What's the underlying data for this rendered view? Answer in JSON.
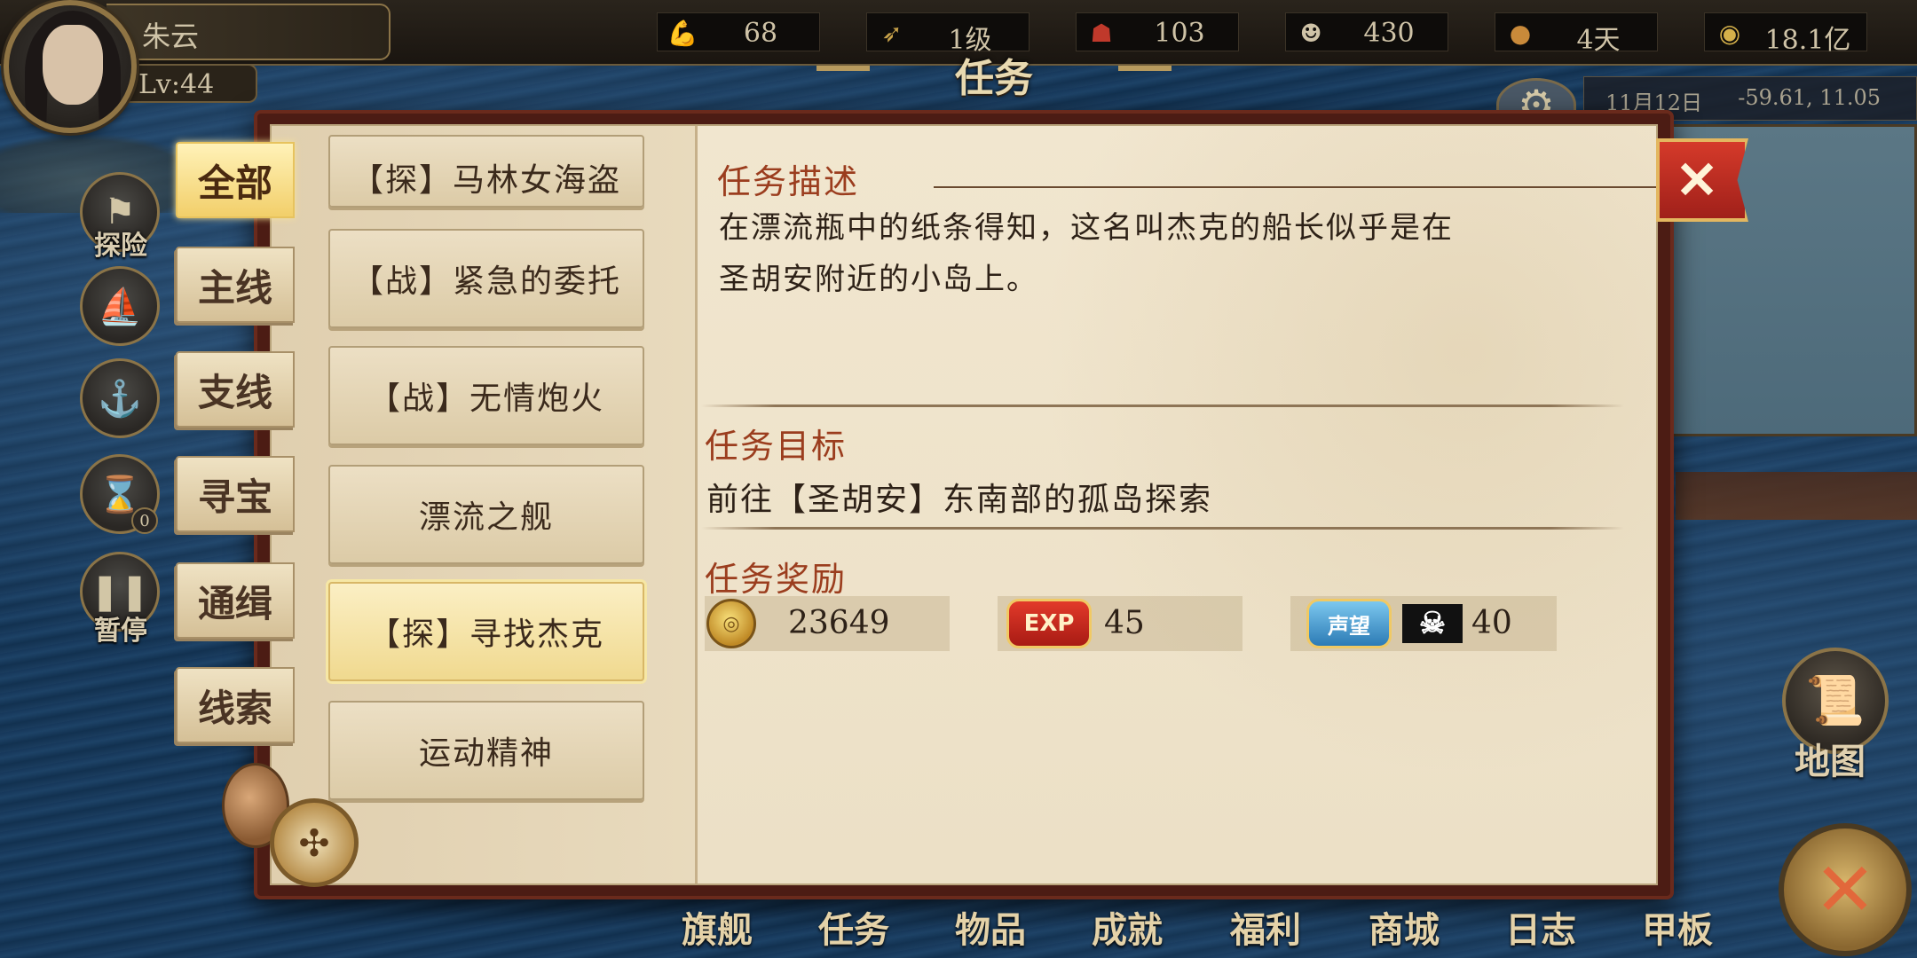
{
  "player": {
    "name": "朱云",
    "level": "Lv:44"
  },
  "stats": [
    {
      "icon": "muscle-icon",
      "value": "68"
    },
    {
      "icon": "arrow-icon",
      "value": "1级"
    },
    {
      "icon": "crew-icon",
      "value": "103"
    },
    {
      "icon": "sailor-icon",
      "value": "430"
    },
    {
      "icon": "bread-icon",
      "value": "4天"
    },
    {
      "icon": "coin-icon",
      "value": "18.1亿"
    }
  ],
  "title": "任务",
  "location": {
    "date": "11月12日",
    "coords": "-59.61, 11.05"
  },
  "side_buttons": [
    {
      "icon": "flag-icon",
      "label": "探险"
    },
    {
      "icon": "ship-icon",
      "label": ""
    },
    {
      "icon": "anchor-icon",
      "label": ""
    },
    {
      "icon": "hourglass-icon",
      "label": "",
      "badge": "0"
    },
    {
      "icon": "pause-icon",
      "label": "暂停"
    }
  ],
  "categories": [
    "全部",
    "主线",
    "支线",
    "寻宝",
    "通缉",
    "线索"
  ],
  "active_category": "全部",
  "tasks": [
    {
      "label": "【探】马林女海盗",
      "active": false
    },
    {
      "label": "【战】紧急的委托",
      "active": false
    },
    {
      "label": "【战】无情炮火",
      "active": false
    },
    {
      "label": "漂流之舰",
      "active": false
    },
    {
      "label": "【探】寻找杰克",
      "active": true
    },
    {
      "label": "运动精神",
      "active": false
    }
  ],
  "detail": {
    "desc_title": "任务描述",
    "desc_line1": "在漂流瓶中的纸条得知，这名叫杰克的船长似乎是在",
    "desc_line2": "圣胡安附近的小岛上。",
    "goal_title": "任务目标",
    "goal_text": "前往【圣胡安】东南部的孤岛探索",
    "reward_title": "任务奖励",
    "rewards": {
      "gold": "23649",
      "exp_label": "EXP",
      "exp": "45",
      "fame_label": "声望",
      "fame": "40"
    }
  },
  "close_label": "✕",
  "bottom_nav": [
    "旗舰",
    "任务",
    "物品",
    "成就",
    "福利",
    "商城",
    "日志",
    "甲板"
  ],
  "map_label": "地图",
  "colors": {
    "accent_red": "#9b3d1e",
    "parchment": "#eadcc0",
    "frame": "#4c1c14",
    "active_gold": "#f2cf6a"
  }
}
